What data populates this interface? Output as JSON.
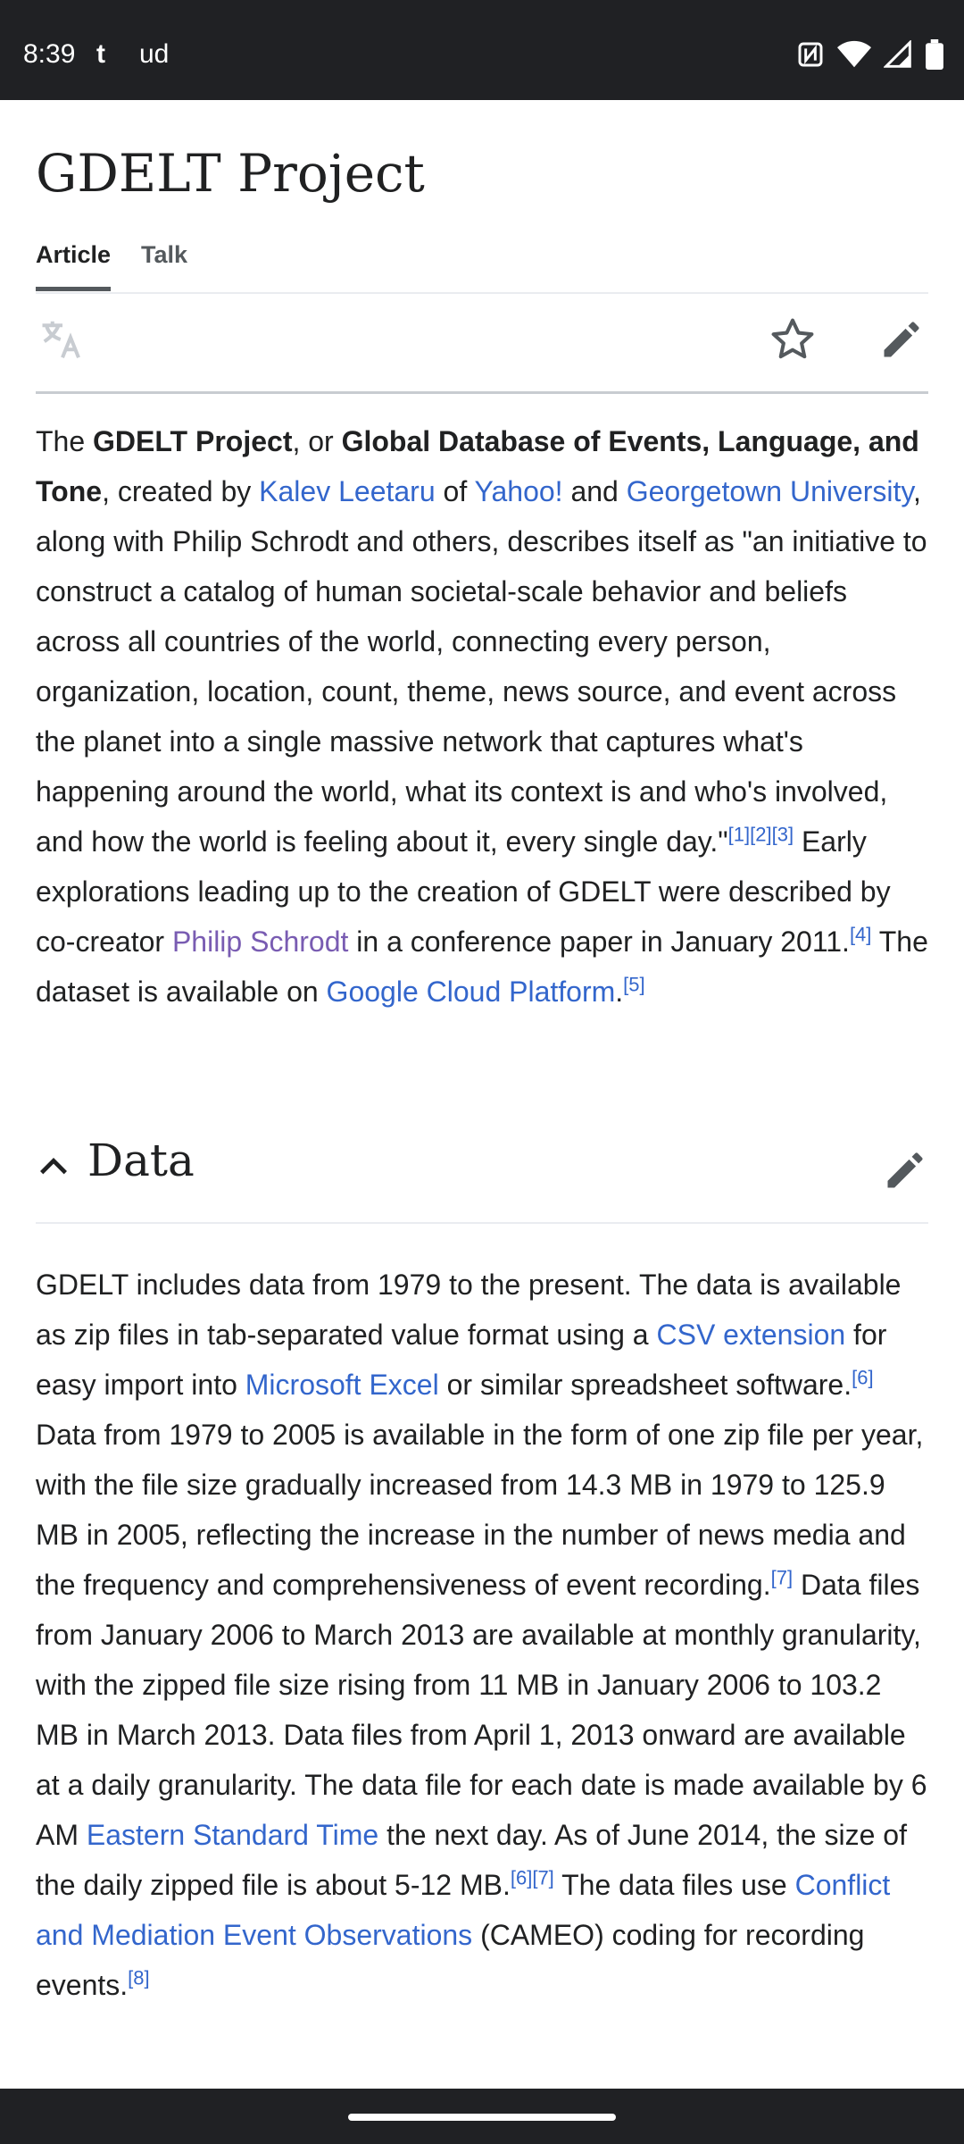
{
  "status_bar": {
    "time": "8:39",
    "icons": [
      "tumblr-icon",
      "udp-icon",
      "nfc-icon",
      "wifi-icon",
      "signal-icon",
      "battery-icon"
    ]
  },
  "article": {
    "title": "GDELT Project",
    "tabs": [
      {
        "label": "Article",
        "active": true
      },
      {
        "label": "Talk",
        "active": false
      }
    ]
  },
  "intro": {
    "t1": "The ",
    "b1": "GDELT Project",
    "t2": ", or ",
    "b2": "Global Database of Events, Language, and Tone",
    "t3": ", created by ",
    "l1": "Kalev Leetaru",
    "t4": " of ",
    "l2": "Yahoo!",
    "t5": " and ",
    "l3": "Georgetown University",
    "t6": ", along with Philip Schrodt and others, describes itself as \"an initiative to construct a catalog of human societal-scale behavior and beliefs across all countries of the world, connecting every person, organization, location, count, theme, news source, and event across the planet into a single massive network that captures what's happening around the world, what its context is and who's involved, and how the world is feeling about it, every single day.\"",
    "r1": "[1]",
    "r2": "[2]",
    "r3": "[3]",
    "t7": " Early explorations leading up to the creation of GDELT were described by co-creator ",
    "l4": "Philip Schrodt",
    "t8": " in a conference paper in January 2011.",
    "r4": "[4]",
    "t9": " The dataset is available on ",
    "l5": "Google Cloud Platform",
    "t10": ".",
    "r5": "[5]"
  },
  "section": {
    "heading": "Data",
    "t1": "GDELT includes data from 1979 to the present. The data is available as zip files in tab-separated value format using a ",
    "l1": "CSV extension",
    "t2": " for easy import into ",
    "l2": "Microsoft Excel",
    "t3": " or similar spreadsheet software.",
    "r1": "[6]",
    "t4": " Data from 1979 to 2005 is available in the form of one zip file per year, with the file size gradually increased from 14.3 MB in 1979 to 125.9 MB in 2005, reflecting the increase in the number of news media and the frequency and comprehensiveness of event recording.",
    "r2": "[7]",
    "t5": " Data files from January 2006 to March 2013 are available at monthly granularity, with the zipped file size rising from 11 MB in January 2006 to 103.2 MB in March 2013. Data files from April 1, 2013 onward are available at a daily granularity. The data file for each date is made available by 6 AM ",
    "l3": "Eastern Standard Time",
    "t6": " the next day. As of June 2014, the size of the daily zipped file is about 5-12 MB.",
    "r3": "[6]",
    "r4": "[7]",
    "t7": " The data files use ",
    "l4": "Conflict and Mediation Event Observations",
    "t8": " (CAMEO) coding for recording events.",
    "r5": "[8]"
  },
  "colors": {
    "link": "#3366cc",
    "visited_link": "#795cb2",
    "text": "#202122",
    "system_bar": "#202124"
  }
}
